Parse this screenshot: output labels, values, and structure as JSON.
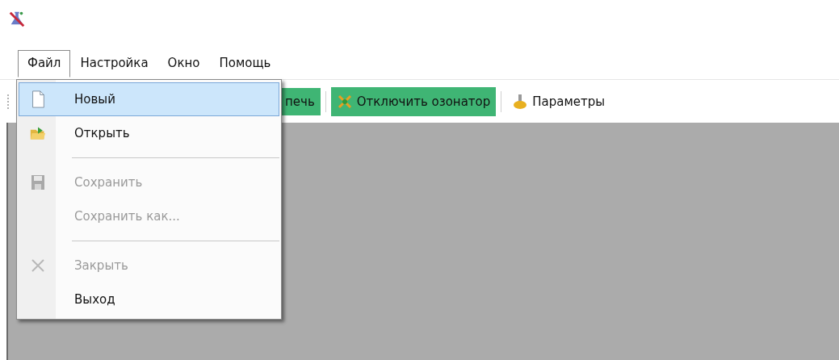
{
  "menu_bar": [
    {
      "label": "Файл",
      "selected": true
    },
    {
      "label": "Настройка",
      "selected": false
    },
    {
      "label": "Окно",
      "selected": false
    },
    {
      "label": "Помощь",
      "selected": false
    }
  ],
  "toolbar": [
    {
      "label": "печь",
      "active": true
    },
    {
      "label": "Отключить озонатор",
      "active": true
    },
    {
      "label": "Параметры",
      "active": false
    }
  ],
  "file_menu": [
    {
      "kind": "item",
      "label": "Новый",
      "selected": true,
      "disabled": false
    },
    {
      "kind": "item",
      "label": "Открыть",
      "selected": false,
      "disabled": false
    },
    {
      "kind": "separator"
    },
    {
      "kind": "item",
      "label": "Сохранить",
      "selected": false,
      "disabled": true
    },
    {
      "kind": "item",
      "label": "Сохранить как...",
      "selected": false,
      "disabled": true
    },
    {
      "kind": "separator"
    },
    {
      "kind": "item",
      "label": "Закрыть",
      "selected": false,
      "disabled": true
    },
    {
      "kind": "item",
      "label": "Выход",
      "selected": false,
      "disabled": false
    }
  ]
}
